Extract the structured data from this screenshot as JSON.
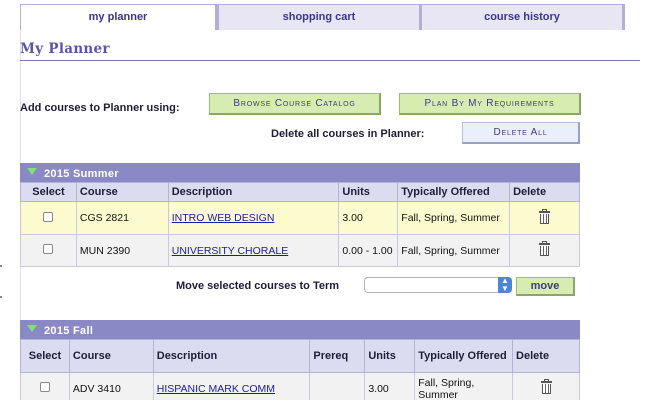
{
  "tabs": [
    {
      "label": "my planner",
      "active": true
    },
    {
      "label": "shopping cart",
      "active": false
    },
    {
      "label": "course history",
      "active": false
    }
  ],
  "page_title": "My Planner",
  "add_courses": {
    "label": "Add courses to Planner using:",
    "browse_button": "Browse Course Catalog",
    "plan_button": "Plan By My Requirements"
  },
  "delete_all": {
    "label": "Delete all courses in Planner:",
    "button": "Delete All"
  },
  "term1": {
    "name": "2015 Summer",
    "columns": [
      "Select",
      "Course",
      "Description",
      "Units",
      "Typically Offered",
      "Delete"
    ],
    "rows": [
      {
        "course": "CGS 2821",
        "description": "INTRO WEB DESIGN",
        "units": "3.00",
        "offered": "Fall, Spring, Summer",
        "highlighted": true
      },
      {
        "course": "MUN 2390",
        "description": "UNIVERSITY CHORALE",
        "units": "0.00 - 1.00",
        "offered": "Fall, Spring, Summer",
        "highlighted": false
      }
    ]
  },
  "move": {
    "label": "Move selected courses to Term",
    "selected_term": "",
    "button": "move"
  },
  "term2": {
    "name": "2015 Fall",
    "columns": [
      "Select",
      "Course",
      "Description",
      "Prereq",
      "Units",
      "Typically Offered",
      "Delete"
    ],
    "rows": [
      {
        "course": "ADV 3410",
        "description": "HISPANIC MARK COMM",
        "prereq": "",
        "units": "3.00",
        "offered": "Fall, Spring, Summer"
      }
    ]
  },
  "colors": {
    "term_header": "#8b88c6",
    "highlight_row": "#fbfbcf",
    "green_button": "#d6ecb1",
    "title": "#5a55a6"
  }
}
